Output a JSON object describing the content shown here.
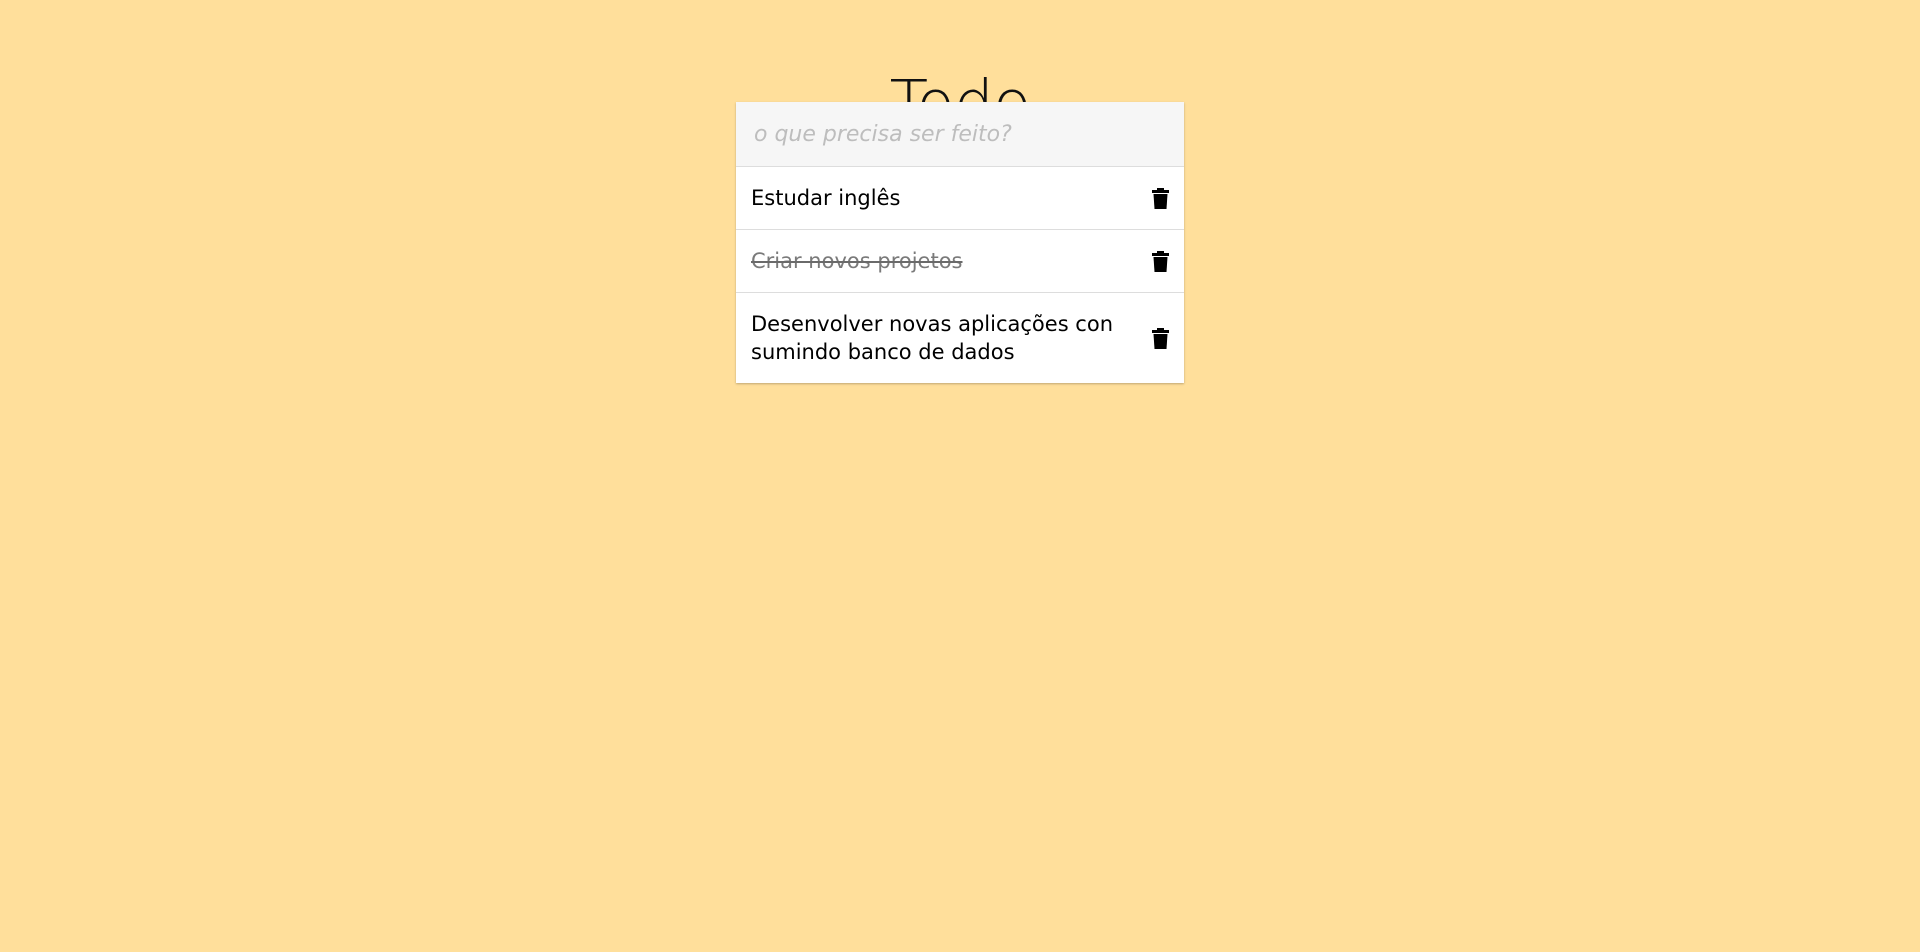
{
  "header": {
    "title": "Todo"
  },
  "new_todo": {
    "placeholder": "o que precisa ser feito?",
    "value": ""
  },
  "todos": [
    {
      "text": "Estudar inglês",
      "completed": false,
      "delete_icon": "trash-icon"
    },
    {
      "text": "Criar novos projetos",
      "completed": true,
      "delete_icon": "trash-icon"
    },
    {
      "text": "Desenvolver novas aplicações con sumindo banco de dados",
      "completed": false,
      "delete_icon": "trash-icon"
    }
  ],
  "colors": {
    "background": "#FFDF9B",
    "panel": "#FFFFFF",
    "input_background": "#F6F6F6",
    "completed_text": "#7A7A7A"
  }
}
